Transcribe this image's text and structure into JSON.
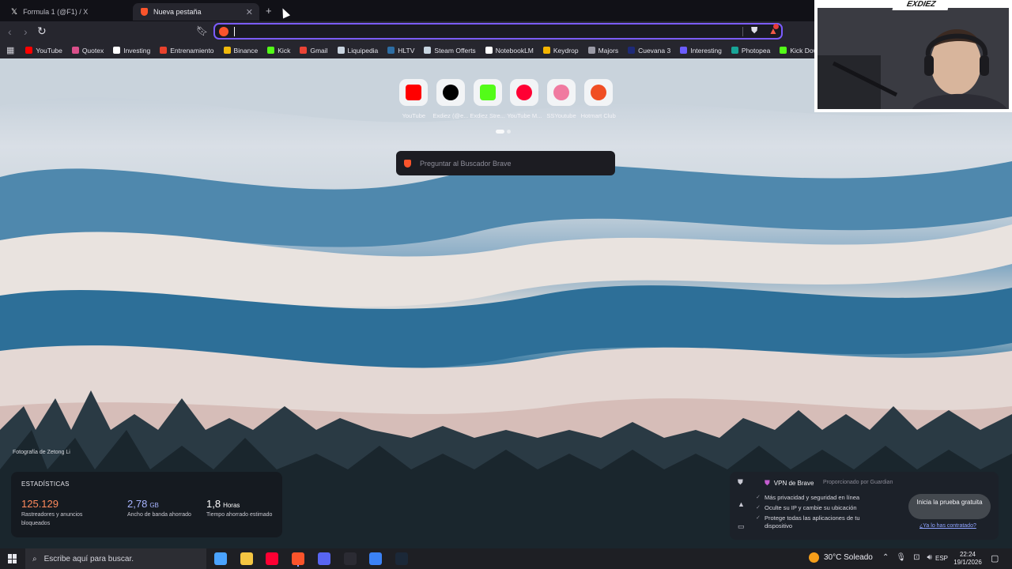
{
  "tabs": [
    {
      "title": "Formula 1 (@F1) / X",
      "active": false
    },
    {
      "title": "Nueva pestaña",
      "active": true
    }
  ],
  "toolbar": {
    "omnibox_value": ""
  },
  "bookmarks": [
    {
      "label": "YouTube",
      "color": "#ff0000"
    },
    {
      "label": "Quotex",
      "color": "#d94f8a"
    },
    {
      "label": "Investing",
      "color": "#ffffff"
    },
    {
      "label": "Entrenamiento",
      "color": "#e8412c"
    },
    {
      "label": "Binance",
      "color": "#f0b90b"
    },
    {
      "label": "Kick",
      "color": "#53fc18"
    },
    {
      "label": "Gmail",
      "color": "#ea4335"
    },
    {
      "label": "Liquipedia",
      "color": "#c9d4e0"
    },
    {
      "label": "HLTV",
      "color": "#2d6da3"
    },
    {
      "label": "Steam Offerts",
      "color": "#c7d5e0"
    },
    {
      "label": "NotebookLM",
      "color": "#ffffff"
    },
    {
      "label": "Keydrop",
      "color": "#f4b400"
    },
    {
      "label": "Majors",
      "color": "#9a9aa6"
    },
    {
      "label": "Cuevana 3",
      "color": "#1e2a78"
    },
    {
      "label": "Interesting",
      "color": "#6b5cff"
    },
    {
      "label": "Photopea",
      "color": "#18a497"
    },
    {
      "label": "Kick Download",
      "color": "#53fc18"
    }
  ],
  "webcam": {
    "name": "EXDIEZ"
  },
  "top_sites": [
    {
      "label": "YouTube",
      "icon": "youtube-icon",
      "color": "#ff0000"
    },
    {
      "label": "Exdiez (@e...",
      "icon": "tiktok-icon",
      "color": "#000000"
    },
    {
      "label": "Exdiez Stre...",
      "icon": "kick-icon",
      "color": "#53fc18"
    },
    {
      "label": "YouTube M...",
      "icon": "youtube-music-icon",
      "color": "#ff0033"
    },
    {
      "label": "SSYoutube",
      "icon": "ssyoutube-icon",
      "color": "#f07aa0"
    },
    {
      "label": "Hotmart Club",
      "icon": "hotmart-icon",
      "color": "#f04e23"
    }
  ],
  "search": {
    "placeholder": "Preguntar al Buscador Brave"
  },
  "photo_credit": "Fotografía de Zetong Li",
  "stats": {
    "title": "ESTADÍSTICAS",
    "items": [
      {
        "value": "125.129",
        "unit": "",
        "label": "Rastreadores y anuncios bloqueados",
        "color": "#ff8a5c"
      },
      {
        "value": "2,78",
        "unit": "GB",
        "label": "Ancho de banda ahorrado",
        "color": "#a7b4ff"
      },
      {
        "value": "1,8",
        "unit": "Horas",
        "label": "Tiempo ahorrado estimado",
        "color": "#ffffff"
      }
    ]
  },
  "vpn": {
    "title": "VPN de Brave",
    "powered_by": "Proporcionado por  Guardian",
    "features": [
      "Más privacidad y seguridad en línea",
      "Oculte su IP y cambie su ubicación",
      "Protege todas las aplicaciones de tu dispositivo"
    ],
    "cta": "Inicia la prueba gratuita",
    "link": "¿Ya lo has contratado?"
  },
  "taskbar": {
    "search_placeholder": "Escribe aquí para buscar.",
    "weather": "30°C  Soleado",
    "language": "ESP",
    "time": "22:24",
    "date": "19/1/2026",
    "apps": [
      {
        "name": "copilot-app",
        "color": "#4aa3ff"
      },
      {
        "name": "file-explorer-app",
        "color": "#f4c542"
      },
      {
        "name": "youtube-music-app",
        "color": "#ff0033"
      },
      {
        "name": "brave-app",
        "color": "#fb542b"
      },
      {
        "name": "discord-app",
        "color": "#5865f2"
      },
      {
        "name": "obs-app",
        "color": "#2b2b33"
      },
      {
        "name": "vpn-app",
        "color": "#3b82f6"
      },
      {
        "name": "steam-app",
        "color": "#1b2838"
      }
    ]
  }
}
